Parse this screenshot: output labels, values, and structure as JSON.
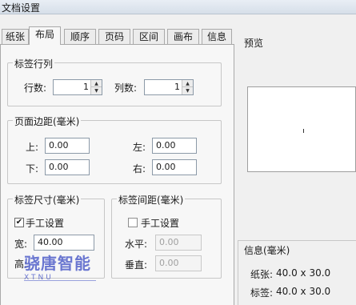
{
  "window": {
    "title": "文档设置"
  },
  "tabs": [
    {
      "label": "纸张"
    },
    {
      "label": "布局"
    },
    {
      "label": "顺序"
    },
    {
      "label": "页码"
    },
    {
      "label": "区间"
    },
    {
      "label": "画布"
    },
    {
      "label": "信息"
    }
  ],
  "active_tab": "布局",
  "label_rows_cols": {
    "title": "标签行列",
    "rows_label": "行数:",
    "rows_value": "1",
    "cols_label": "列数:",
    "cols_value": "1"
  },
  "margins": {
    "title": "页面边距(毫米)",
    "top_label": "上:",
    "top_value": "0.00",
    "bottom_label": "下:",
    "bottom_value": "0.00",
    "left_label": "左:",
    "left_value": "0.00",
    "right_label": "右:",
    "right_value": "0.00"
  },
  "label_size": {
    "title": "标签尺寸(毫米)",
    "manual_label": "手工设置",
    "manual_checked": true,
    "width_label": "宽:",
    "width_value": "40.00",
    "height_label": "高:"
  },
  "label_spacing": {
    "title": "标签间距(毫米)",
    "manual_label": "手工设置",
    "manual_checked": false,
    "horizontal_label": "水平:",
    "horizontal_value": "0.00",
    "vertical_label": "垂直:",
    "vertical_value": "0.00"
  },
  "preview": {
    "title": "预览"
  },
  "info": {
    "title": "信息(毫米)",
    "paper_label": "纸张:",
    "paper_value": "40.0 x 30.0",
    "label_label": "标签:",
    "label_value": "40.0 x 30.0"
  },
  "watermark": {
    "text": "骁唐智能",
    "sub": "XTNU"
  },
  "colors": {
    "watermark": "#3b4cc4",
    "panel_bg": "#f7f7f7"
  }
}
